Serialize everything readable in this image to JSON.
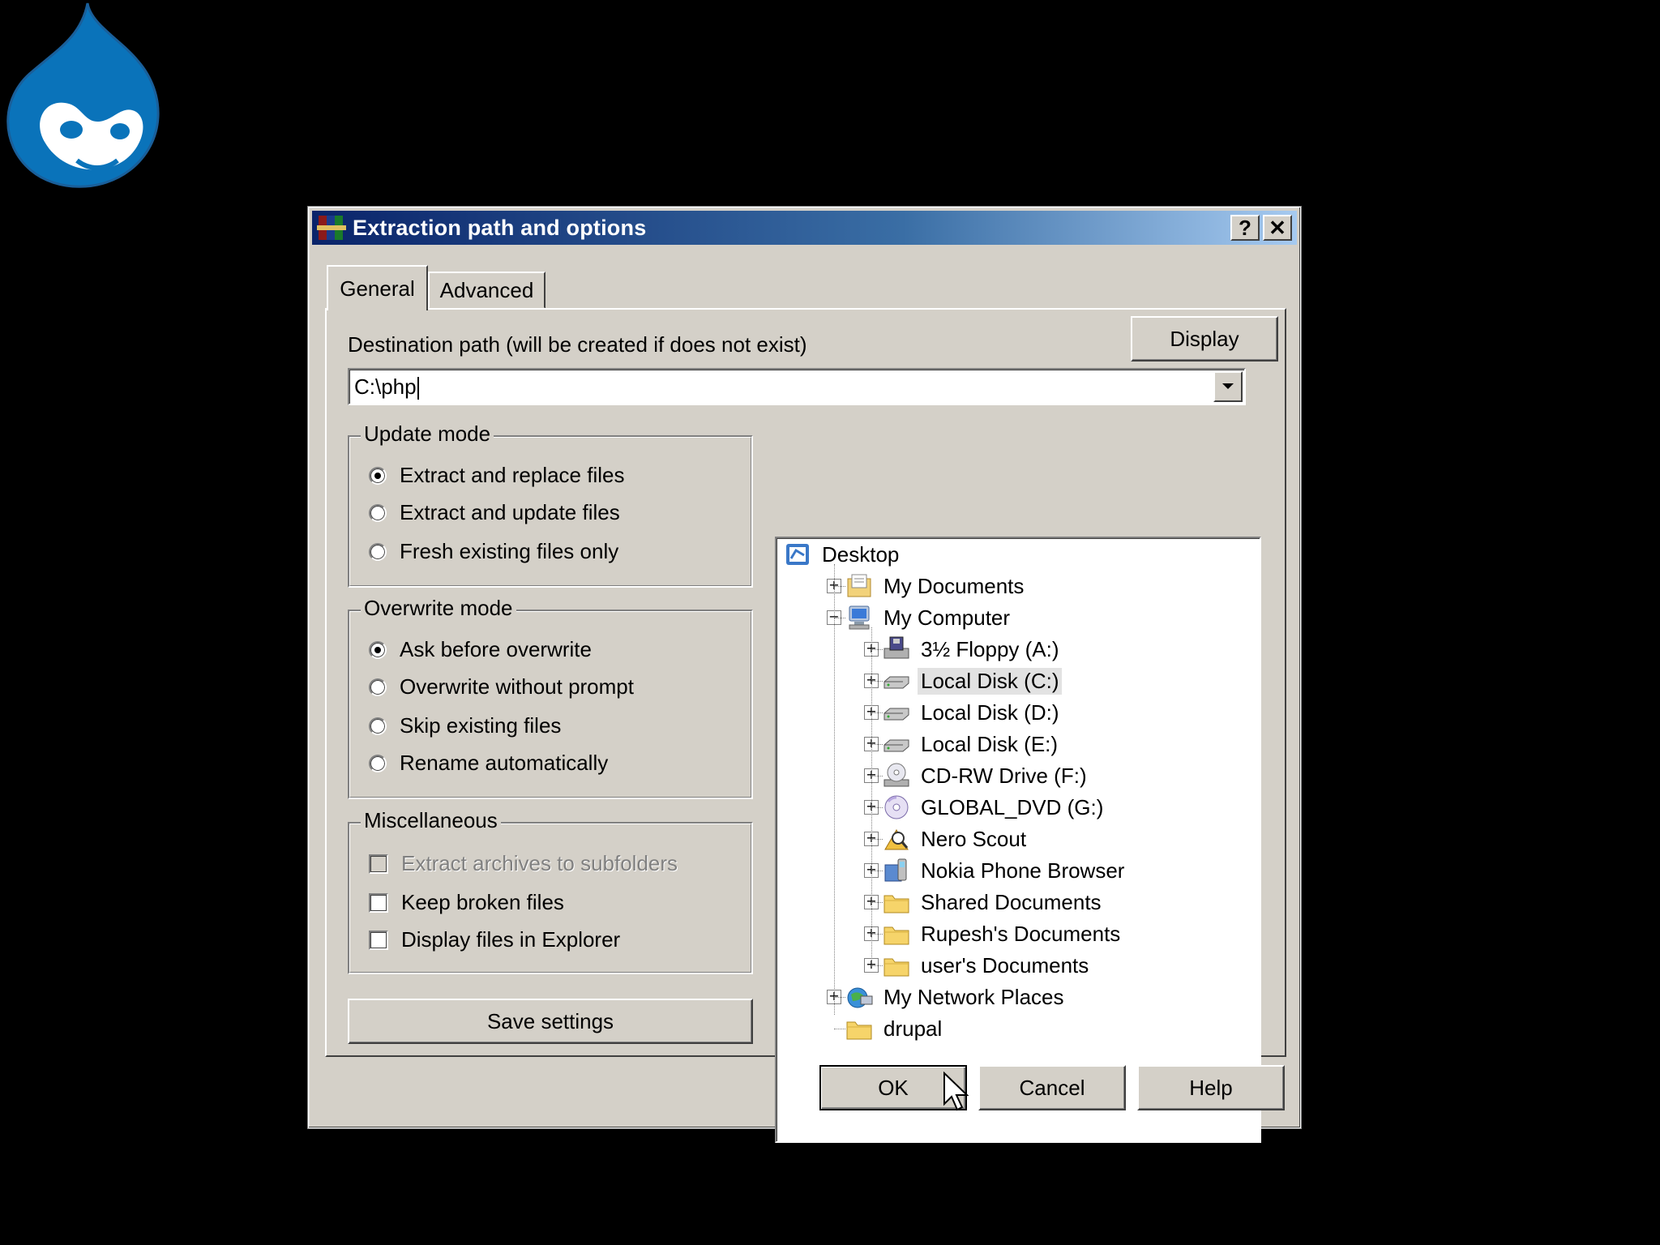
{
  "dialog": {
    "title": "Extraction path and options",
    "help_glyph": "?",
    "close_glyph": "✕"
  },
  "tabs": [
    {
      "label": "General",
      "active": true
    },
    {
      "label": "Advanced",
      "active": false
    }
  ],
  "destination": {
    "label": "Destination path (will be created if does not exist)",
    "value": "C:\\php",
    "display_button": "Display"
  },
  "update_mode": {
    "title": "Update mode",
    "options": [
      {
        "label": "Extract and replace files",
        "selected": true
      },
      {
        "label": "Extract and update files",
        "selected": false
      },
      {
        "label": "Fresh existing files only",
        "selected": false
      }
    ]
  },
  "overwrite_mode": {
    "title": "Overwrite mode",
    "options": [
      {
        "label": "Ask before overwrite",
        "selected": true
      },
      {
        "label": "Overwrite without prompt",
        "selected": false
      },
      {
        "label": "Skip existing files",
        "selected": false
      },
      {
        "label": "Rename automatically",
        "selected": false
      }
    ]
  },
  "misc": {
    "title": "Miscellaneous",
    "options": [
      {
        "label": "Extract archives to subfolders",
        "checked": false,
        "disabled": true
      },
      {
        "label": "Keep broken files",
        "checked": false,
        "disabled": false
      },
      {
        "label": "Display files in Explorer",
        "checked": false,
        "disabled": false
      }
    ]
  },
  "save_settings": "Save settings",
  "tree": [
    {
      "label": "Desktop",
      "icon": "desktop-icon",
      "level": 0,
      "expander": ""
    },
    {
      "label": "My Documents",
      "icon": "my-documents-icon",
      "level": 1,
      "expander": "+"
    },
    {
      "label": "My Computer",
      "icon": "my-computer-icon",
      "level": 1,
      "expander": "−"
    },
    {
      "label": "3½ Floppy (A:)",
      "icon": "floppy-drive-icon",
      "level": 2,
      "expander": "+"
    },
    {
      "label": "Local Disk (C:)",
      "icon": "hard-drive-icon",
      "level": 2,
      "expander": "+",
      "selected": true
    },
    {
      "label": "Local Disk (D:)",
      "icon": "hard-drive-icon",
      "level": 2,
      "expander": "+"
    },
    {
      "label": "Local Disk (E:)",
      "icon": "hard-drive-icon",
      "level": 2,
      "expander": "+"
    },
    {
      "label": "CD-RW Drive (F:)",
      "icon": "cd-drive-icon",
      "level": 2,
      "expander": "+"
    },
    {
      "label": "GLOBAL_DVD (G:)",
      "icon": "dvd-drive-icon",
      "level": 2,
      "expander": "+"
    },
    {
      "label": "Nero Scout",
      "icon": "nero-scout-icon",
      "level": 2,
      "expander": "+"
    },
    {
      "label": "Nokia Phone Browser",
      "icon": "phone-browser-icon",
      "level": 2,
      "expander": "+"
    },
    {
      "label": "Shared Documents",
      "icon": "folder-icon",
      "level": 2,
      "expander": "+"
    },
    {
      "label": "Rupesh's Documents",
      "icon": "folder-icon",
      "level": 2,
      "expander": "+"
    },
    {
      "label": "user's Documents",
      "icon": "folder-icon",
      "level": 2,
      "expander": "+"
    },
    {
      "label": "My Network Places",
      "icon": "network-places-icon",
      "level": 1,
      "expander": "+"
    },
    {
      "label": "drupal",
      "icon": "folder-icon",
      "level": 1,
      "expander": ""
    }
  ],
  "buttons": {
    "ok": "OK",
    "cancel": "Cancel",
    "help": "Help"
  }
}
